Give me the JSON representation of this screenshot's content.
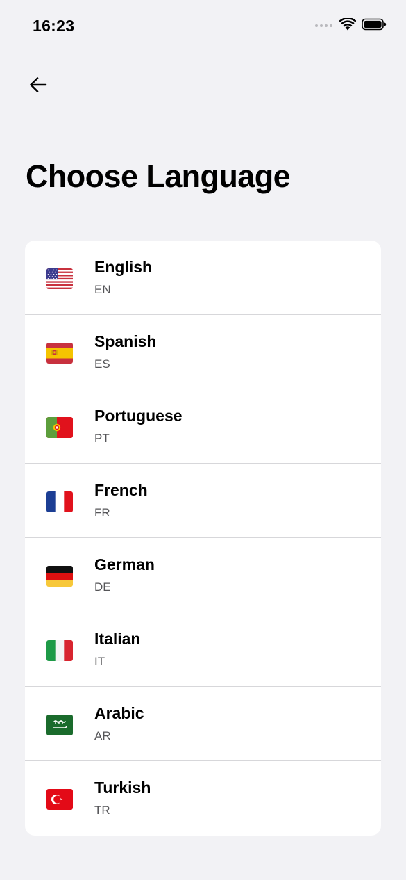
{
  "status_bar": {
    "time": "16:23"
  },
  "header": {
    "back_icon": "arrow-left-icon",
    "title": "Choose Language"
  },
  "languages": [
    {
      "name": "English",
      "code": "EN",
      "flag": "us-flag-icon"
    },
    {
      "name": "Spanish",
      "code": "ES",
      "flag": "spain-flag-icon"
    },
    {
      "name": "Portuguese",
      "code": "PT",
      "flag": "portugal-flag-icon"
    },
    {
      "name": "French",
      "code": "FR",
      "flag": "france-flag-icon"
    },
    {
      "name": "German",
      "code": "DE",
      "flag": "germany-flag-icon"
    },
    {
      "name": "Italian",
      "code": "IT",
      "flag": "italy-flag-icon"
    },
    {
      "name": "Arabic",
      "code": "AR",
      "flag": "saudi-arabia-flag-icon"
    },
    {
      "name": "Turkish",
      "code": "TR",
      "flag": "turkey-flag-icon"
    }
  ],
  "colors": {
    "background": "#f2f2f5",
    "card": "#ffffff",
    "divider": "#d7d7da",
    "secondary_text": "#555558"
  }
}
